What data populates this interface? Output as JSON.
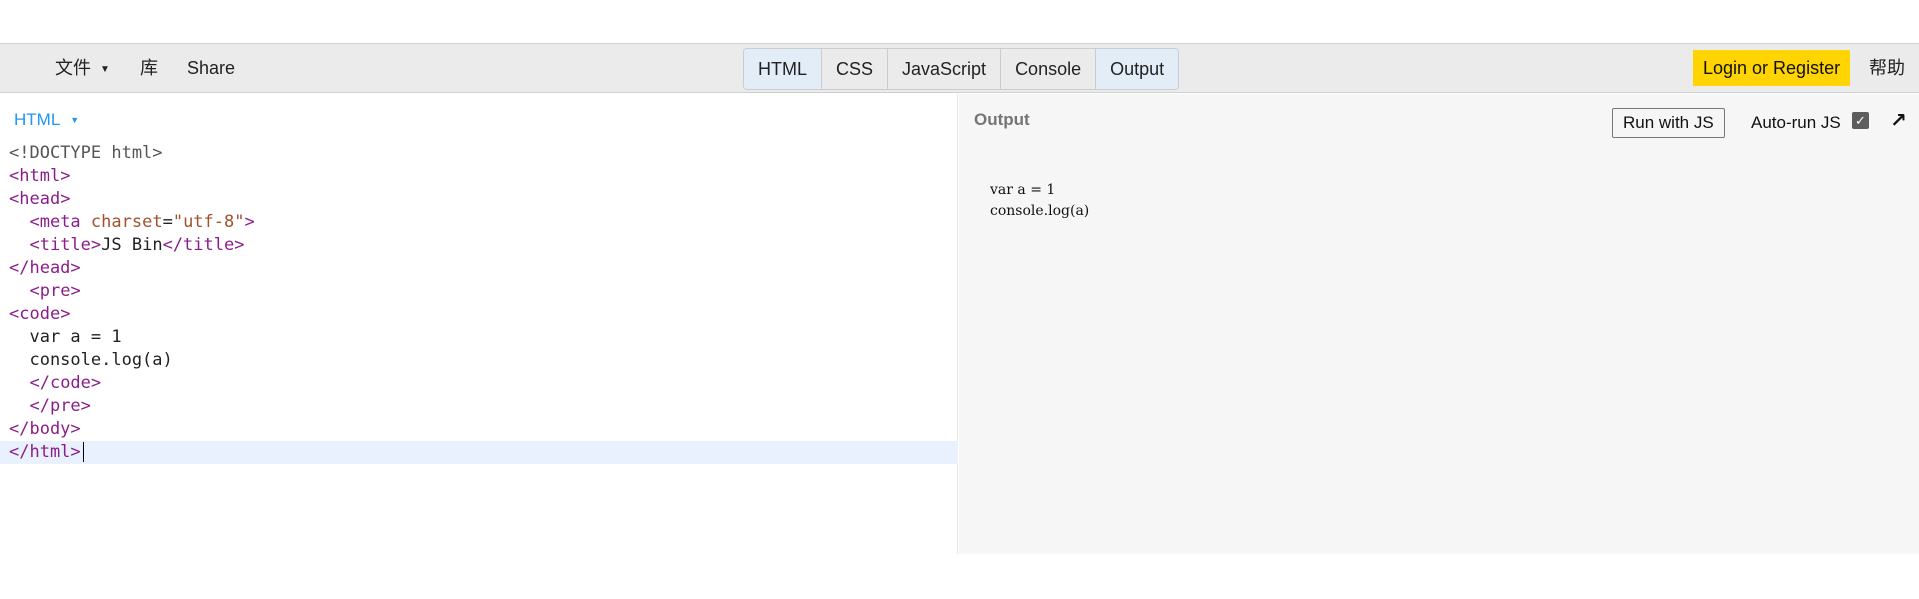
{
  "toolbar": {
    "file_label": "文件",
    "library_label": "库",
    "share_label": "Share",
    "panel_tabs": [
      "HTML",
      "CSS",
      "JavaScript",
      "Console",
      "Output"
    ],
    "active_tabs": [
      "HTML",
      "Output"
    ],
    "login_label": "Login or Register",
    "help_label": "帮助",
    "login_color": "#ffd400"
  },
  "editor": {
    "language_label": "HTML",
    "lines": [
      "<!DOCTYPE html>",
      "<html>",
      "<head>",
      "  <meta charset=\"utf-8\">",
      "  <title>JS Bin</title>",
      "</head>",
      "  <pre>",
      "<code>",
      "  var a = 1",
      "  console.log(a)",
      "  </code>",
      "  </pre>",
      "</body>",
      "</html>"
    ],
    "current_line": 14,
    "colors": {
      "tag": "#8b1d8b",
      "attr": "#a0522d",
      "string": "#a0522d",
      "doctype": "#555555",
      "text": "#222222"
    }
  },
  "output": {
    "label": "Output",
    "run_button_label": "Run with JS",
    "autorun_label": "Auto-run JS",
    "autorun_checked": true,
    "popout_icon": "arrow-up-right-icon",
    "content_lines": [
      "var a = 1",
      "console.log(a)"
    ]
  }
}
